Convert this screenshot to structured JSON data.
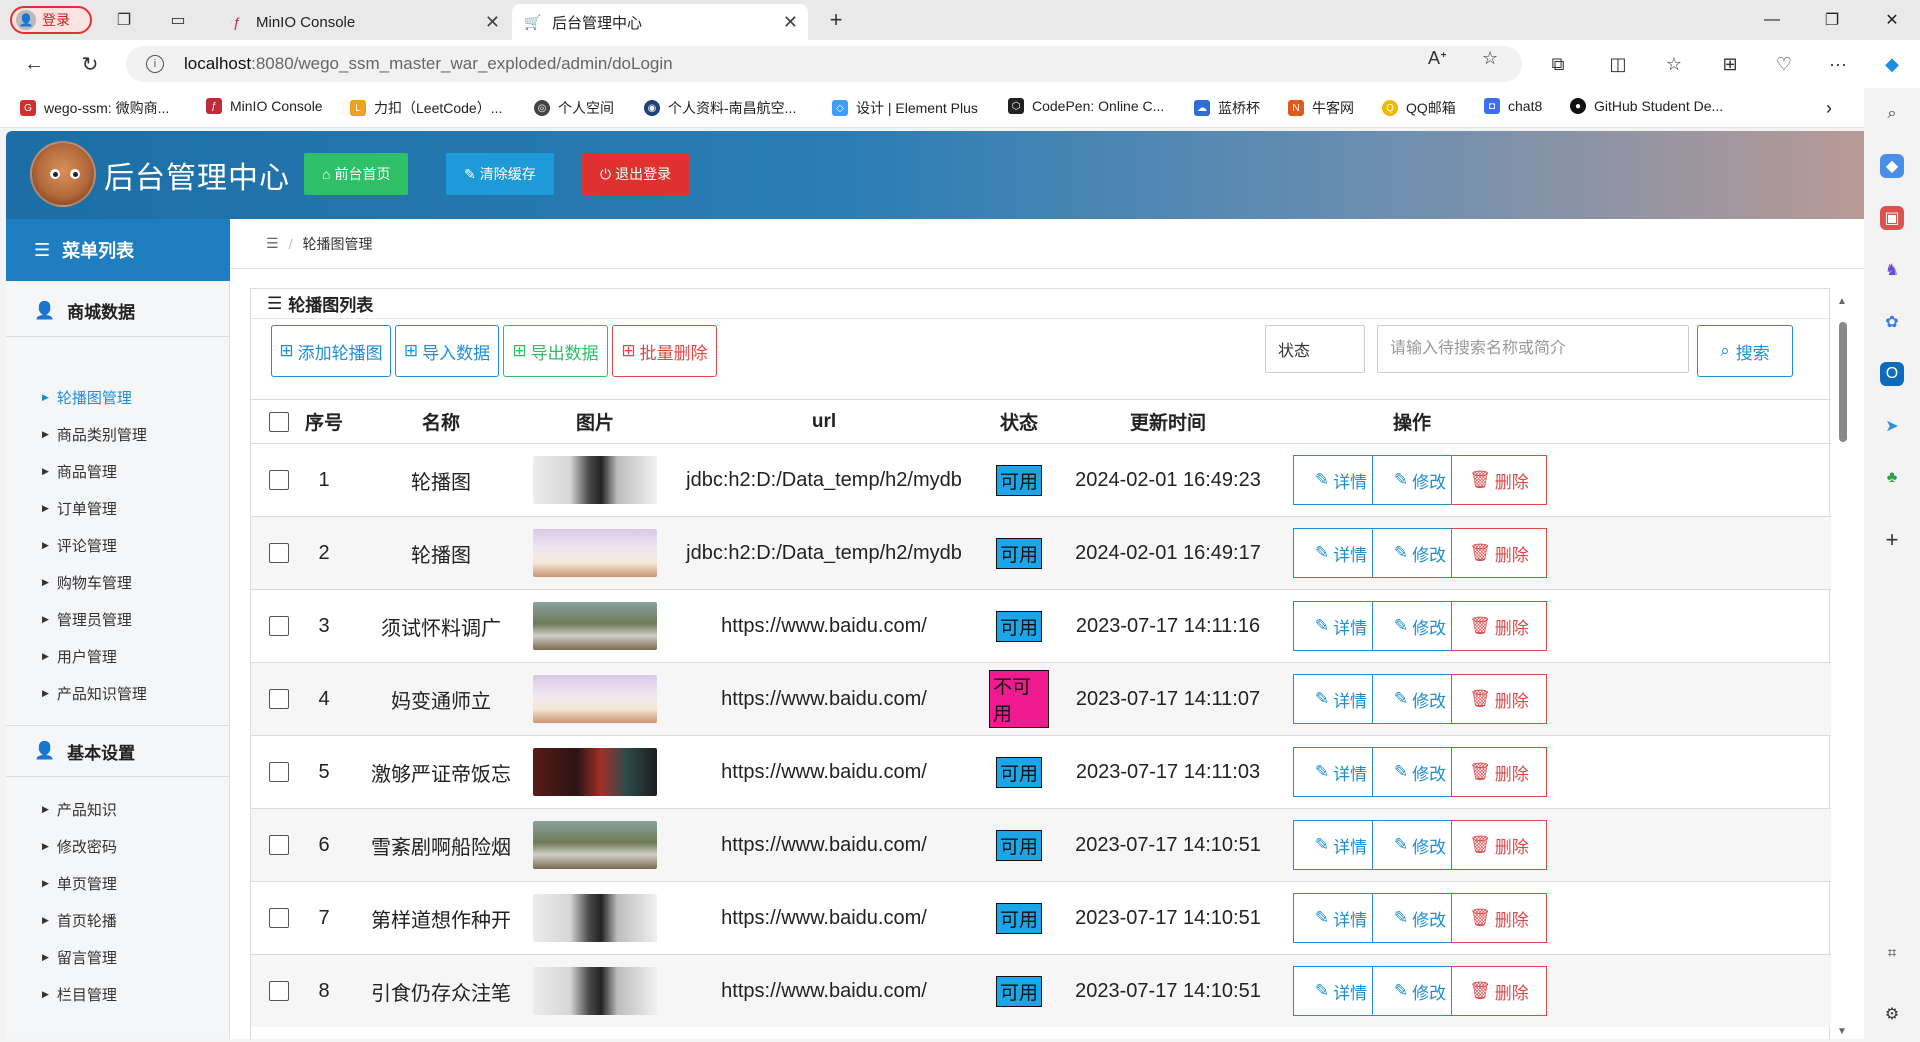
{
  "browser": {
    "profile_label": "登录",
    "tabs": [
      {
        "title": "MinIO Console",
        "favicon": "minio-icon"
      },
      {
        "title": "后台管理中心",
        "favicon": "cart-icon"
      }
    ],
    "url_host": "localhost",
    "url_path": ":8080/wego_ssm_master_war_exploded/admin/doLogin",
    "bookmarks": [
      {
        "label": "wego-ssm: 微购商...",
        "color": "#d32f2f"
      },
      {
        "label": "MinIO Console",
        "color": "#c6283b"
      },
      {
        "label": "力扣（LeetCode）...",
        "color": "#f0a020"
      },
      {
        "label": "个人空间",
        "color": "#444444"
      },
      {
        "label": "个人资料-南昌航空...",
        "color": "#1d3f7a"
      },
      {
        "label": "设计 | Element Plus",
        "color": "#409eff"
      },
      {
        "label": "CodePen: Online C...",
        "color": "#222222"
      },
      {
        "label": "蓝桥杯",
        "color": "#2f6fd3"
      },
      {
        "label": "牛客网",
        "color": "#e05a1e"
      },
      {
        "label": "QQ邮箱",
        "color": "#f5b800"
      },
      {
        "label": "chat8",
        "color": "#3b6ef5"
      },
      {
        "label": "GitHub Student De...",
        "color": "#111111"
      }
    ]
  },
  "app": {
    "title": "后台管理中心",
    "header_buttons": [
      {
        "label": "前台首页",
        "color": "#2fbf67",
        "icon": "home-icon"
      },
      {
        "label": "清除缓存",
        "color": "#1e9ad9",
        "icon": "wrench-icon"
      },
      {
        "label": "退出登录",
        "color": "#e03131",
        "icon": "power-icon"
      }
    ]
  },
  "sidebar": {
    "header": "菜单列表",
    "groups": [
      {
        "title": "商城数据",
        "items": [
          "轮播图管理",
          "商品类别管理",
          "商品管理",
          "订单管理",
          "评论管理",
          "购物车管理",
          "管理员管理",
          "用户管理",
          "产品知识管理"
        ]
      },
      {
        "title": "基本设置",
        "items": [
          "产品知识",
          "修改密码",
          "单页管理",
          "首页轮播",
          "留言管理",
          "栏目管理"
        ]
      }
    ],
    "active_item": "轮播图管理"
  },
  "breadcrumb": {
    "current": "轮播图管理"
  },
  "panel": {
    "title": "轮播图列表",
    "toolbar": [
      {
        "label": "添加轮播图",
        "color": "#1e8fd6"
      },
      {
        "label": "导入数据",
        "color": "#1e8fd6"
      },
      {
        "label": "导出数据",
        "color": "#2fbf67"
      },
      {
        "label": "批量删除",
        "color": "#e04848"
      }
    ],
    "status_select": "状态",
    "search_placeholder": "请输入待搜索名称或简介",
    "search_label": "搜索"
  },
  "table": {
    "columns": [
      "序号",
      "名称",
      "图片",
      "url",
      "状态",
      "更新时间",
      "操作"
    ],
    "ops": {
      "detail": "详情",
      "edit": "修改",
      "delete": "删除"
    },
    "rows": [
      {
        "no": "1",
        "name": "轮播图",
        "img": "face",
        "url": "jdbc:h2:D:/Data_temp/h2/mydb",
        "status": "可用",
        "ok": true,
        "time": "2024-02-01 16:49:23"
      },
      {
        "no": "2",
        "name": "轮播图",
        "img": "cups",
        "url": "jdbc:h2:D:/Data_temp/h2/mydb",
        "status": "可用",
        "ok": true,
        "time": "2024-02-01 16:49:17"
      },
      {
        "no": "3",
        "name": "须试怀料调广",
        "img": "castle",
        "url": "https://www.baidu.com/",
        "status": "可用",
        "ok": true,
        "time": "2023-07-17 14:11:16"
      },
      {
        "no": "4",
        "name": "妈变通师立",
        "img": "cups",
        "url": "https://www.baidu.com/",
        "status": "不可用",
        "ok": false,
        "time": "2023-07-17 14:11:07"
      },
      {
        "no": "5",
        "name": "激够严证帝饭忘",
        "img": "dark",
        "url": "https://www.baidu.com/",
        "status": "可用",
        "ok": true,
        "time": "2023-07-17 14:11:03"
      },
      {
        "no": "6",
        "name": "雪紊剧啊船险烟",
        "img": "castle",
        "url": "https://www.baidu.com/",
        "status": "可用",
        "ok": true,
        "time": "2023-07-17 14:10:51"
      },
      {
        "no": "7",
        "name": "第样道想作种开",
        "img": "face",
        "url": "https://www.baidu.com/",
        "status": "可用",
        "ok": true,
        "time": "2023-07-17 14:10:51"
      },
      {
        "no": "8",
        "name": "引食仍存众注笔",
        "img": "face",
        "url": "https://www.baidu.com/",
        "status": "可用",
        "ok": true,
        "time": "2023-07-17 14:10:51"
      }
    ]
  }
}
